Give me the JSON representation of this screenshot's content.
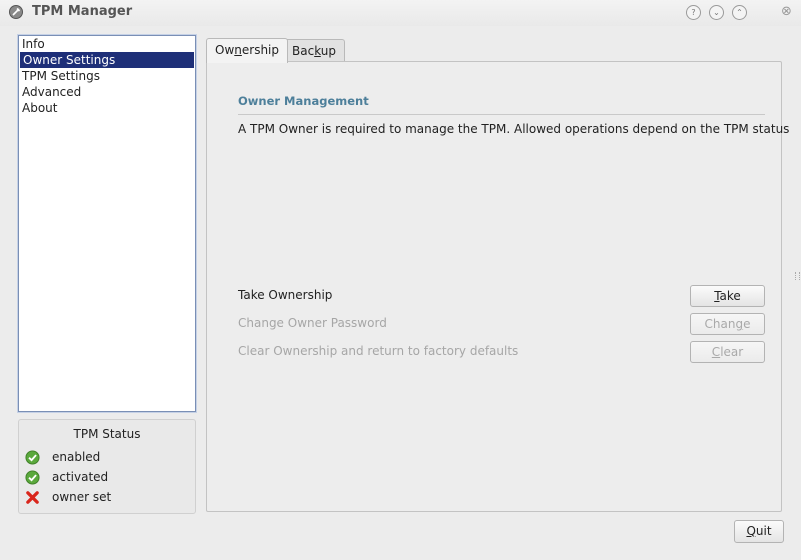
{
  "window": {
    "title": "TPM Manager",
    "controls": {
      "help": "?",
      "minimize": "⌄",
      "maximize": "⌃",
      "close": "⊗"
    }
  },
  "sidebar": {
    "items": [
      {
        "label": "Info",
        "selected": false
      },
      {
        "label": "Owner Settings",
        "selected": true
      },
      {
        "label": "TPM Settings",
        "selected": false
      },
      {
        "label": "Advanced",
        "selected": false
      },
      {
        "label": "About",
        "selected": false
      }
    ]
  },
  "status": {
    "title": "TPM Status",
    "rows": [
      {
        "label": "enabled",
        "icon": "check-icon",
        "color": "#5aa83c"
      },
      {
        "label": "activated",
        "icon": "check-icon",
        "color": "#5aa83c"
      },
      {
        "label": "owner set",
        "icon": "cross-icon",
        "color": "#d9261c"
      }
    ]
  },
  "tabs": [
    {
      "label_pre": "Ow",
      "mnemonic": "n",
      "label_post": "ership",
      "active": true
    },
    {
      "label_pre": "Bac",
      "mnemonic": "k",
      "label_post": "up",
      "active": false
    }
  ],
  "panel": {
    "heading": "Owner Management",
    "description": "A TPM Owner is required to manage the TPM. Allowed operations depend on the TPM status",
    "operations": [
      {
        "label": "Take Ownership",
        "enabled": true,
        "button_pre": "",
        "button_mn": "T",
        "button_post": "ake"
      },
      {
        "label": "Change Owner Password",
        "enabled": false,
        "button_pre": "Chan",
        "button_mn": "g",
        "button_post": "e"
      },
      {
        "label": "Clear Ownership and return to factory defaults",
        "enabled": false,
        "button_pre": "",
        "button_mn": "C",
        "button_post": "lear"
      }
    ]
  },
  "footer": {
    "quit_mn": "Q",
    "quit_post": "uit"
  },
  "colors": {
    "accent_heading": "#4d7f9a",
    "selection": "#1e2f78"
  }
}
